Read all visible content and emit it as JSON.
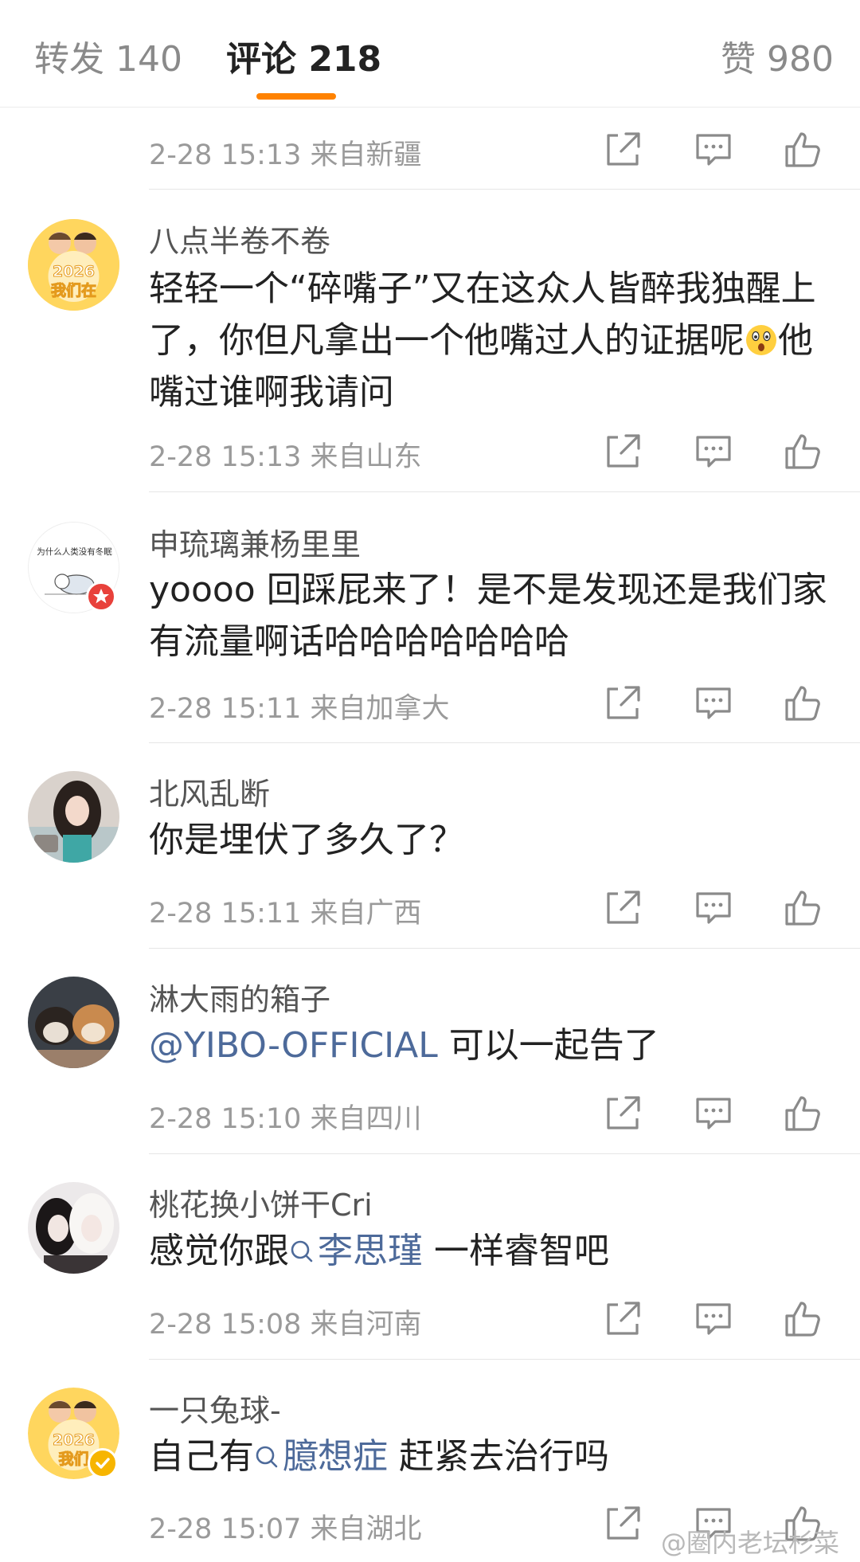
{
  "tabs": {
    "repost": "转发 140",
    "comments": "评论 218",
    "likes": "赞 980"
  },
  "top_meta": "2-28 15:13 来自新疆",
  "comments": [
    {
      "user": "八点半卷不卷",
      "avatar_text": [
        "2026",
        "我们在"
      ],
      "text_before_emoji": "轻轻一个“碎嘴子”又在这众人皆醉我独醒上了，你但凡拿出一个他嘴过人的证据呢",
      "text_after_emoji": "他嘴过谁啊我请问",
      "meta": "2-28 15:13 来自山东"
    },
    {
      "user": "申琉璃兼杨里里",
      "avatar_text": [
        "为什么人类没有冬眠"
      ],
      "text": "yoooo 回踩屁来了！是不是发现还是我们家有流量啊话哈哈哈哈哈哈哈",
      "meta": "2-28 15:11 来自加拿大"
    },
    {
      "user": "北风乱断",
      "text": "你是埋伏了多久了？",
      "meta": "2-28 15:11 来自广西"
    },
    {
      "user": "淋大雨的箱子",
      "mention": "@YIBO-OFFICIAL",
      "text_after": " 可以一起告了",
      "meta": "2-28 15:10 来自四川"
    },
    {
      "user": "桃花换小饼干Cri",
      "text_before": "感觉你跟",
      "topic": "李思瑾",
      "text_after": " 一样睿智吧",
      "meta": "2-28 15:08 来自河南"
    },
    {
      "user": "一只兔球-",
      "avatar_text": [
        "2026",
        "我们"
      ],
      "text_before": "自己有",
      "topic": "臆想症",
      "text_after": " 赶紧去治行吗",
      "meta": "2-28 15:07 来自湖北"
    }
  ],
  "watermark": "@圈内老坛杉菜",
  "icons": {
    "share": "share-icon",
    "reply": "comment-icon",
    "like": "thumbs-up-icon",
    "topic": "search-icon",
    "emoji": "surprised-emoji-icon"
  },
  "colors": {
    "accent": "#ff8200",
    "link": "#4d6a9a",
    "meta_text": "#9a9a9a",
    "username": "#555555"
  }
}
